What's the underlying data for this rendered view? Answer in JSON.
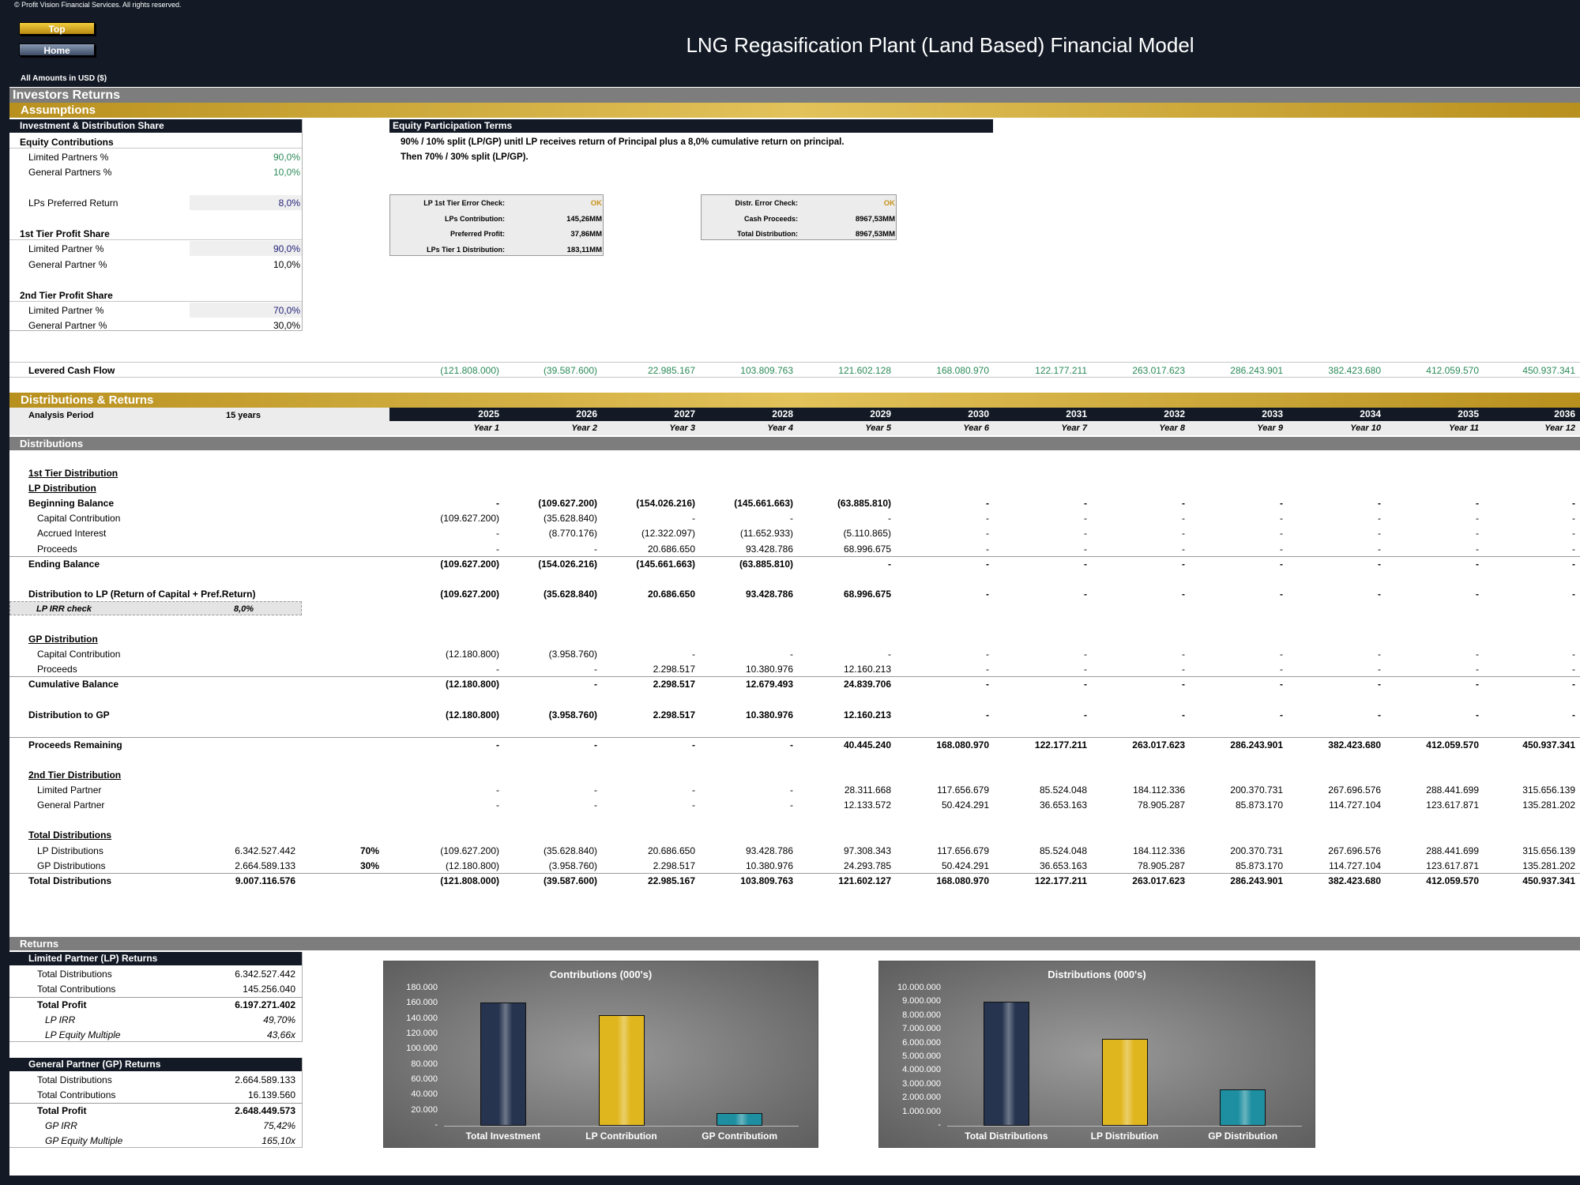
{
  "header": {
    "copyright": "© Profit Vision Financial Services. All rights reserved.",
    "btn_top": "Top",
    "btn_home": "Home",
    "amounts": "All Amounts in  USD ($)",
    "title": "LNG Regasification Plant (Land Based) Financial Model"
  },
  "sections": {
    "investors_returns": "Investors Returns",
    "assumptions": "Assumptions",
    "dist_returns": "Distributions & Returns",
    "distributions": "Distributions",
    "returns": "Returns"
  },
  "ids": {
    "heading": "Investment & Distribution Share",
    "equity_contrib": "Equity Contributions",
    "lp_pct": "Limited Partners %",
    "lp_pct_v": "90,0%",
    "gp_pct": "General Partners %",
    "gp_pct_v": "10,0%",
    "pref": "LPs Preferred Return",
    "pref_v": "8,0%",
    "tier1": "1st Tier Profit Share",
    "t1_lp": "Limited Partner %",
    "t1_lp_v": "90,0%",
    "t1_gp": "General Partner %",
    "t1_gp_v": "10,0%",
    "tier2": "2nd Tier Profit Share",
    "t2_lp": "Limited Partner %",
    "t2_lp_v": "70,0%",
    "t2_gp": "General Partner %",
    "t2_gp_v": "30,0%"
  },
  "terms": {
    "heading": "Equity Participation Terms",
    "line1": "90% / 10% split (LP/GP) unitl LP receives return of Principal plus a 8,0% cumulative return on principal.",
    "line2": "Then 70% / 30% split (LP/GP)."
  },
  "check1": [
    {
      "label": "LP 1st Tier Error Check:",
      "value": "OK"
    },
    {
      "label": "LPs Contribution:",
      "value": "145,26MM"
    },
    {
      "label": "Preferred Profit:",
      "value": "37,86MM"
    },
    {
      "label": "LPs Tier 1 Distribution:",
      "value": "183,11MM"
    }
  ],
  "check2": [
    {
      "label": "Distr. Error Check:",
      "value": "OK"
    },
    {
      "label": "Cash Proceeds:",
      "value": "8967,53MM"
    },
    {
      "label": "Total Distribution:",
      "value": "8967,53MM"
    }
  ],
  "levered": {
    "label": "Levered Cash Flow",
    "values": [
      "(121.808.000)",
      "(39.587.600)",
      "22.985.167",
      "103.809.763",
      "121.602.128",
      "168.080.970",
      "122.177.211",
      "263.017.623",
      "286.243.901",
      "382.423.680",
      "412.059.570",
      "450.937.341"
    ]
  },
  "period": {
    "label": "Analysis Period",
    "value": "15 years",
    "years": [
      "2025",
      "2026",
      "2027",
      "2028",
      "2029",
      "2030",
      "2031",
      "2032",
      "2033",
      "2034",
      "2035",
      "2036"
    ],
    "year_labels": [
      "Year 1",
      "Year 2",
      "Year 3",
      "Year 4",
      "Year 5",
      "Year 6",
      "Year 7",
      "Year 8",
      "Year 9",
      "Year 10",
      "Year 11",
      "Year 12"
    ]
  },
  "rows": [
    {
      "label": "1st Tier Distribution",
      "style": "bu",
      "values": []
    },
    {
      "label": "LP Distribution",
      "style": "bu",
      "values": []
    },
    {
      "label": "Beginning Balance",
      "style": "b",
      "values": [
        "-",
        "(109.627.200)",
        "(154.026.216)",
        "(145.661.663)",
        "(63.885.810)",
        "-",
        "-",
        "-",
        "-",
        "-",
        "-",
        "-"
      ]
    },
    {
      "label": "Capital Contribution",
      "style": "ind",
      "values": [
        "(109.627.200)",
        "(35.628.840)",
        "-",
        "-",
        "-",
        "-",
        "-",
        "-",
        "-",
        "-",
        "-",
        "-"
      ]
    },
    {
      "label": "Accrued Interest",
      "style": "ind",
      "values": [
        "-",
        "(8.770.176)",
        "(12.322.097)",
        "(11.652.933)",
        "(5.110.865)",
        "-",
        "-",
        "-",
        "-",
        "-",
        "-",
        "-"
      ]
    },
    {
      "label": "Proceeds",
      "style": "ind",
      "values": [
        "-",
        "-",
        "20.686.650",
        "93.428.786",
        "68.996.675",
        "-",
        "-",
        "-",
        "-",
        "-",
        "-",
        "-"
      ]
    },
    {
      "label": "Ending Balance",
      "style": "bt",
      "values": [
        "(109.627.200)",
        "(154.026.216)",
        "(145.661.663)",
        "(63.885.810)",
        "-",
        "-",
        "-",
        "-",
        "-",
        "-",
        "-",
        "-"
      ]
    },
    {
      "label": "",
      "style": "",
      "values": []
    },
    {
      "label": "Distribution to LP (Return of Capital + Pref.Return)",
      "style": "b",
      "values": [
        "(109.627.200)",
        "(35.628.840)",
        "20.686.650",
        "93.428.786",
        "68.996.675",
        "-",
        "-",
        "-",
        "-",
        "-",
        "-",
        "-"
      ]
    },
    {
      "label": "LP IRR check",
      "style": "irr",
      "values": []
    },
    {
      "label": "",
      "style": "",
      "values": []
    },
    {
      "label": "GP Distribution",
      "style": "bu",
      "values": []
    },
    {
      "label": "Capital Contribution",
      "style": "ind",
      "values": [
        "(12.180.800)",
        "(3.958.760)",
        "-",
        "-",
        "-",
        "-",
        "-",
        "-",
        "-",
        "-",
        "-",
        "-"
      ]
    },
    {
      "label": "Proceeds",
      "style": "ind",
      "values": [
        "-",
        "-",
        "2.298.517",
        "10.380.976",
        "12.160.213",
        "-",
        "-",
        "-",
        "-",
        "-",
        "-",
        "-"
      ]
    },
    {
      "label": "Cumulative Balance",
      "style": "bt",
      "values": [
        "(12.180.800)",
        "-",
        "2.298.517",
        "12.679.493",
        "24.839.706",
        "-",
        "-",
        "-",
        "-",
        "-",
        "-",
        "-"
      ]
    },
    {
      "label": "",
      "style": "",
      "values": []
    },
    {
      "label": "Distribution to GP",
      "style": "b",
      "values": [
        "(12.180.800)",
        "(3.958.760)",
        "2.298.517",
        "10.380.976",
        "12.160.213",
        "-",
        "-",
        "-",
        "-",
        "-",
        "-",
        "-"
      ]
    },
    {
      "label": "",
      "style": "",
      "values": []
    },
    {
      "label": "Proceeds Remaining",
      "style": "bt",
      "values": [
        "-",
        "-",
        "-",
        "-",
        "40.445.240",
        "168.080.970",
        "122.177.211",
        "263.017.623",
        "286.243.901",
        "382.423.680",
        "412.059.570",
        "450.937.341"
      ]
    },
    {
      "label": "",
      "style": "",
      "values": []
    },
    {
      "label": "2nd Tier Distribution",
      "style": "bu",
      "values": []
    },
    {
      "label": "Limited Partner",
      "style": "ind",
      "values": [
        "-",
        "-",
        "-",
        "-",
        "28.311.668",
        "117.656.679",
        "85.524.048",
        "184.112.336",
        "200.370.731",
        "267.696.576",
        "288.441.699",
        "315.656.139"
      ]
    },
    {
      "label": "General Partner",
      "style": "ind",
      "values": [
        "-",
        "-",
        "-",
        "-",
        "12.133.572",
        "50.424.291",
        "36.653.163",
        "78.905.287",
        "85.873.170",
        "114.727.104",
        "123.617.871",
        "135.281.202"
      ]
    },
    {
      "label": "",
      "style": "",
      "values": []
    },
    {
      "label": "Total Distributions",
      "style": "bu",
      "values": []
    },
    {
      "label": "LP Distributions",
      "style": "ind",
      "total": "6.342.527.442",
      "pct": "70%",
      "values": [
        "(109.627.200)",
        "(35.628.840)",
        "20.686.650",
        "93.428.786",
        "97.308.343",
        "117.656.679",
        "85.524.048",
        "184.112.336",
        "200.370.731",
        "267.696.576",
        "288.441.699",
        "315.656.139"
      ]
    },
    {
      "label": "GP Distributions",
      "style": "ind",
      "total": "2.664.589.133",
      "pct": "30%",
      "values": [
        "(12.180.800)",
        "(3.958.760)",
        "2.298.517",
        "10.380.976",
        "24.293.785",
        "50.424.291",
        "36.653.163",
        "78.905.287",
        "85.873.170",
        "114.727.104",
        "123.617.871",
        "135.281.202"
      ]
    },
    {
      "label": "Total Distributions",
      "style": "bt",
      "total": "9.007.116.576",
      "values": [
        "(121.808.000)",
        "(39.587.600)",
        "22.985.167",
        "103.809.763",
        "121.602.127",
        "168.080.970",
        "122.177.211",
        "263.017.623",
        "286.243.901",
        "382.423.680",
        "412.059.570",
        "450.937.341"
      ]
    }
  ],
  "lp_irr_check": "8,0%",
  "lp_returns": {
    "heading": "Limited Partner (LP) Returns",
    "rows": [
      {
        "label": "Total Distributions",
        "value": "6.342.527.442",
        "style": "ind"
      },
      {
        "label": "Total Contributions",
        "value": "145.256.040",
        "style": "ind"
      },
      {
        "label": "Total Profit",
        "value": "6.197.271.402",
        "style": "bt"
      },
      {
        "label": "LP IRR",
        "value": "49,70%",
        "style": "it"
      },
      {
        "label": "LP Equity Multiple",
        "value": "43,66x",
        "style": "it"
      }
    ]
  },
  "gp_returns": {
    "heading": "General Partner (GP) Returns",
    "rows": [
      {
        "label": "Total Distributions",
        "value": "2.664.589.133",
        "style": "ind"
      },
      {
        "label": "Total Contributions",
        "value": "16.139.560",
        "style": "ind"
      },
      {
        "label": "Total Profit",
        "value": "2.648.449.573",
        "style": "bt"
      },
      {
        "label": "GP IRR",
        "value": "75,42%",
        "style": "it"
      },
      {
        "label": "GP Equity Multiple",
        "value": "165,10x",
        "style": "it"
      }
    ]
  },
  "chart_data": [
    {
      "type": "bar",
      "title": "Contributions (000's)",
      "categories": [
        "Total Investment",
        "LP Contribution",
        "GP Contributiom"
      ],
      "values": [
        161396,
        145256,
        16140
      ],
      "colors": [
        "#26344f",
        "#e0b61e",
        "#1e8fa0"
      ],
      "ylim": [
        0,
        180000
      ],
      "yticks": [
        "-",
        "20.000",
        "40.000",
        "60.000",
        "80.000",
        "100.000",
        "120.000",
        "140.000",
        "160.000",
        "180.000"
      ]
    },
    {
      "type": "bar",
      "title": "Distributions (000's)",
      "categories": [
        "Total Distributions",
        "LP Distribution",
        "GP Distribution"
      ],
      "values": [
        9007117,
        6342527,
        2664589
      ],
      "colors": [
        "#26344f",
        "#e0b61e",
        "#1e8fa0"
      ],
      "ylim": [
        0,
        10000000
      ],
      "yticks": [
        "-",
        "1.000.000",
        "2.000.000",
        "3.000.000",
        "4.000.000",
        "5.000.000",
        "6.000.000",
        "7.000.000",
        "8.000.000",
        "9.000.000",
        "10.000.000"
      ]
    }
  ]
}
